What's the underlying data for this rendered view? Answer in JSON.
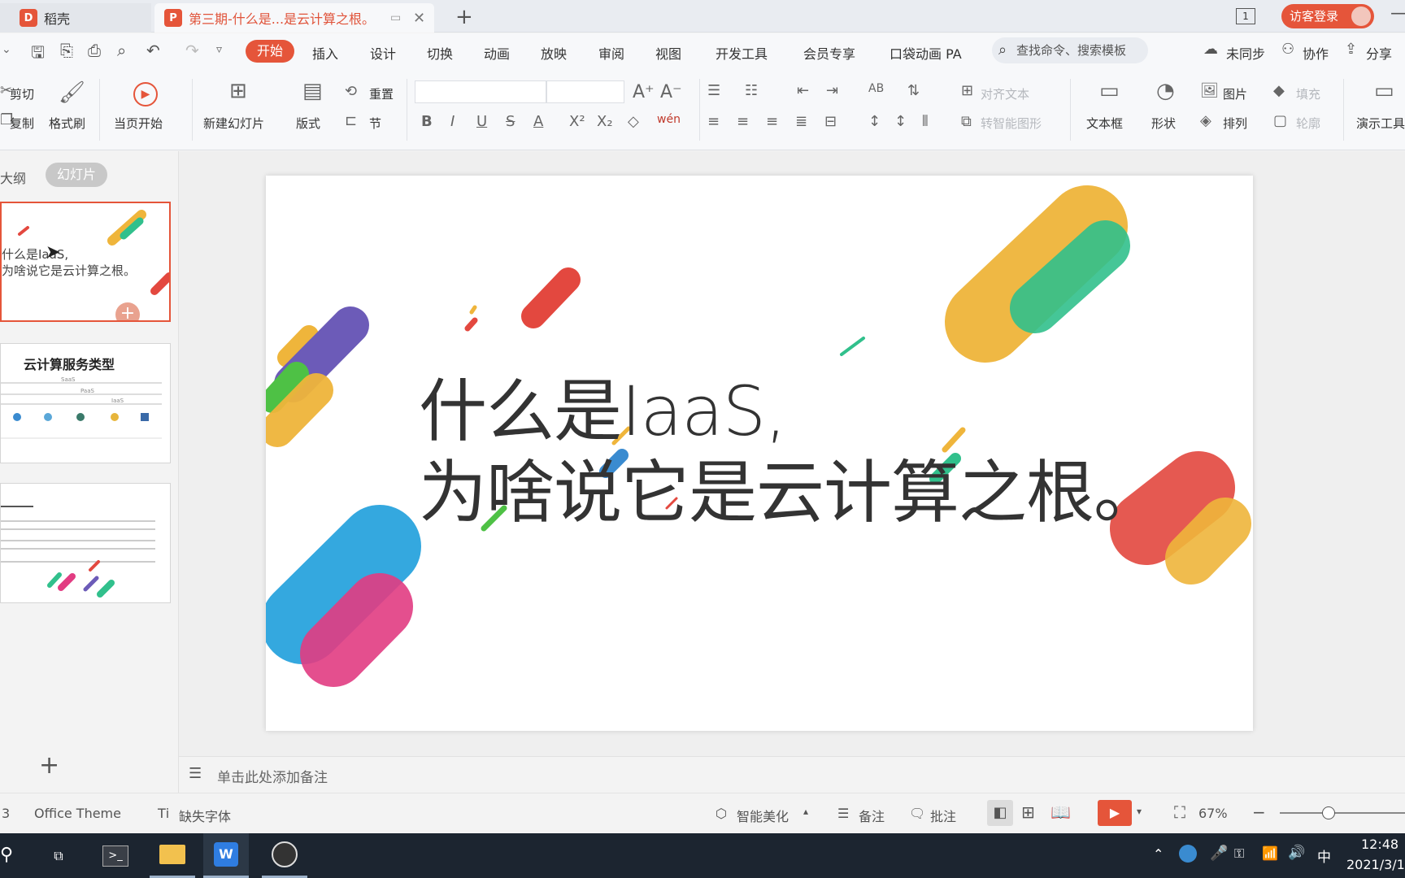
{
  "tabs": {
    "home_label": "稻壳",
    "doc_label": "第三期-什么是...是云计算之根。",
    "add_label": "+"
  },
  "titlebar_right": {
    "page_indicator": "1",
    "login_label": "访客登录"
  },
  "menu": {
    "items": [
      "开始",
      "插入",
      "设计",
      "切换",
      "动画",
      "放映",
      "审阅",
      "视图",
      "开发工具",
      "会员专享",
      "口袋动画 PA"
    ],
    "search_placeholder": "查找命令、搜索模板",
    "sync_label": "未同步",
    "collab_label": "协作",
    "share_label": "分享"
  },
  "ribbon": {
    "cut": "剪切",
    "copy": "复制",
    "format_painter": "格式刷",
    "from_current": "当页开始",
    "new_slide": "新建幻灯片",
    "layout": "版式",
    "reset": "重置",
    "section": "节",
    "align_text": "对齐文本",
    "smart_shape": "转智能图形",
    "textbox": "文本框",
    "shape": "形状",
    "picture": "图片",
    "arrange": "排列",
    "fill": "填充",
    "outline": "轮廓",
    "present_tool": "演示工具",
    "pinyin": "wén"
  },
  "leftpanel": {
    "outline_tab": "大纲",
    "slides_tab": "幻灯片",
    "thumb1_line1": "什么是IaaS,",
    "thumb1_line2": "为啥说它是云计算之根。",
    "thumb2_title": "云计算服务类型",
    "thumb2_saas": "SaaS",
    "thumb2_paas": "PaaS",
    "thumb2_iaas": "IaaS",
    "add_slide": "+"
  },
  "slide": {
    "title_line1": "什么是IaaS,",
    "title_line2": "为啥说它是云计算之根。"
  },
  "notes": {
    "placeholder": "单击此处添加备注"
  },
  "status": {
    "slide_count": "3",
    "theme": "Office Theme",
    "missing_font": "缺失字体",
    "smart_beautify": "智能美化",
    "notes": "备注",
    "comments": "批注",
    "zoom": "67%"
  },
  "taskbar": {
    "time": "12:48",
    "date": "2021/3/1",
    "ime": "中"
  },
  "colors": {
    "accent": "#e5553a",
    "taskbar": "#1c2530",
    "yellow": "#efb53b",
    "green": "#31c08c",
    "purple": "#6c5bb8",
    "red": "#e3483f",
    "blue": "#2aa4de",
    "pink": "#e23c82"
  }
}
